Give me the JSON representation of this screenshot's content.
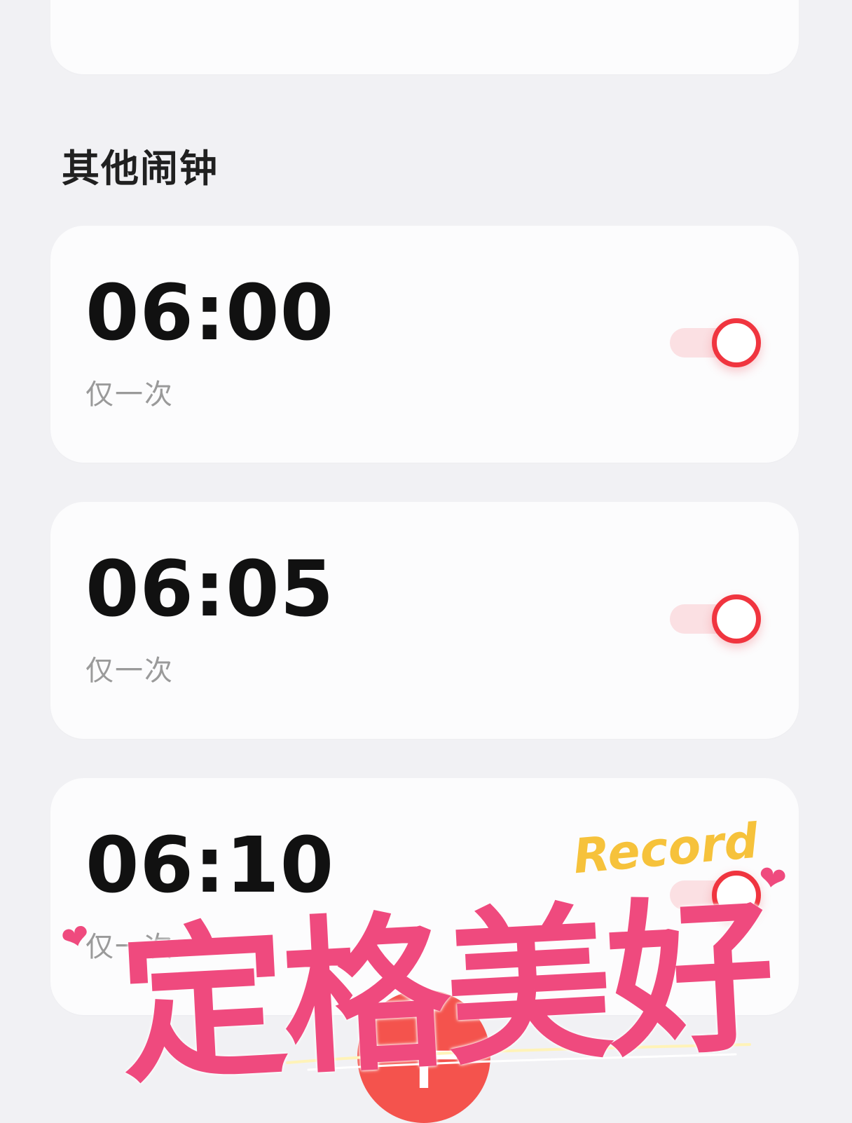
{
  "section_title": "其他闹钟",
  "alarms": [
    {
      "time": "06:00",
      "repeat": "仅一次",
      "enabled": true
    },
    {
      "time": "06:05",
      "repeat": "仅一次",
      "enabled": true
    },
    {
      "time": "06:10",
      "repeat": "仅一次",
      "enabled": true
    }
  ],
  "fab": {
    "label": "+"
  },
  "sticker": {
    "text": "定格美好",
    "record_text": "Record",
    "color": "#ef4a7e",
    "record_color": "#f6c23b"
  },
  "colors": {
    "background": "#f1f1f4",
    "card": "#fcfcfd",
    "accent": "#f0353f",
    "toggle_track": "#fbe0e3",
    "fab": "#f4534d"
  }
}
